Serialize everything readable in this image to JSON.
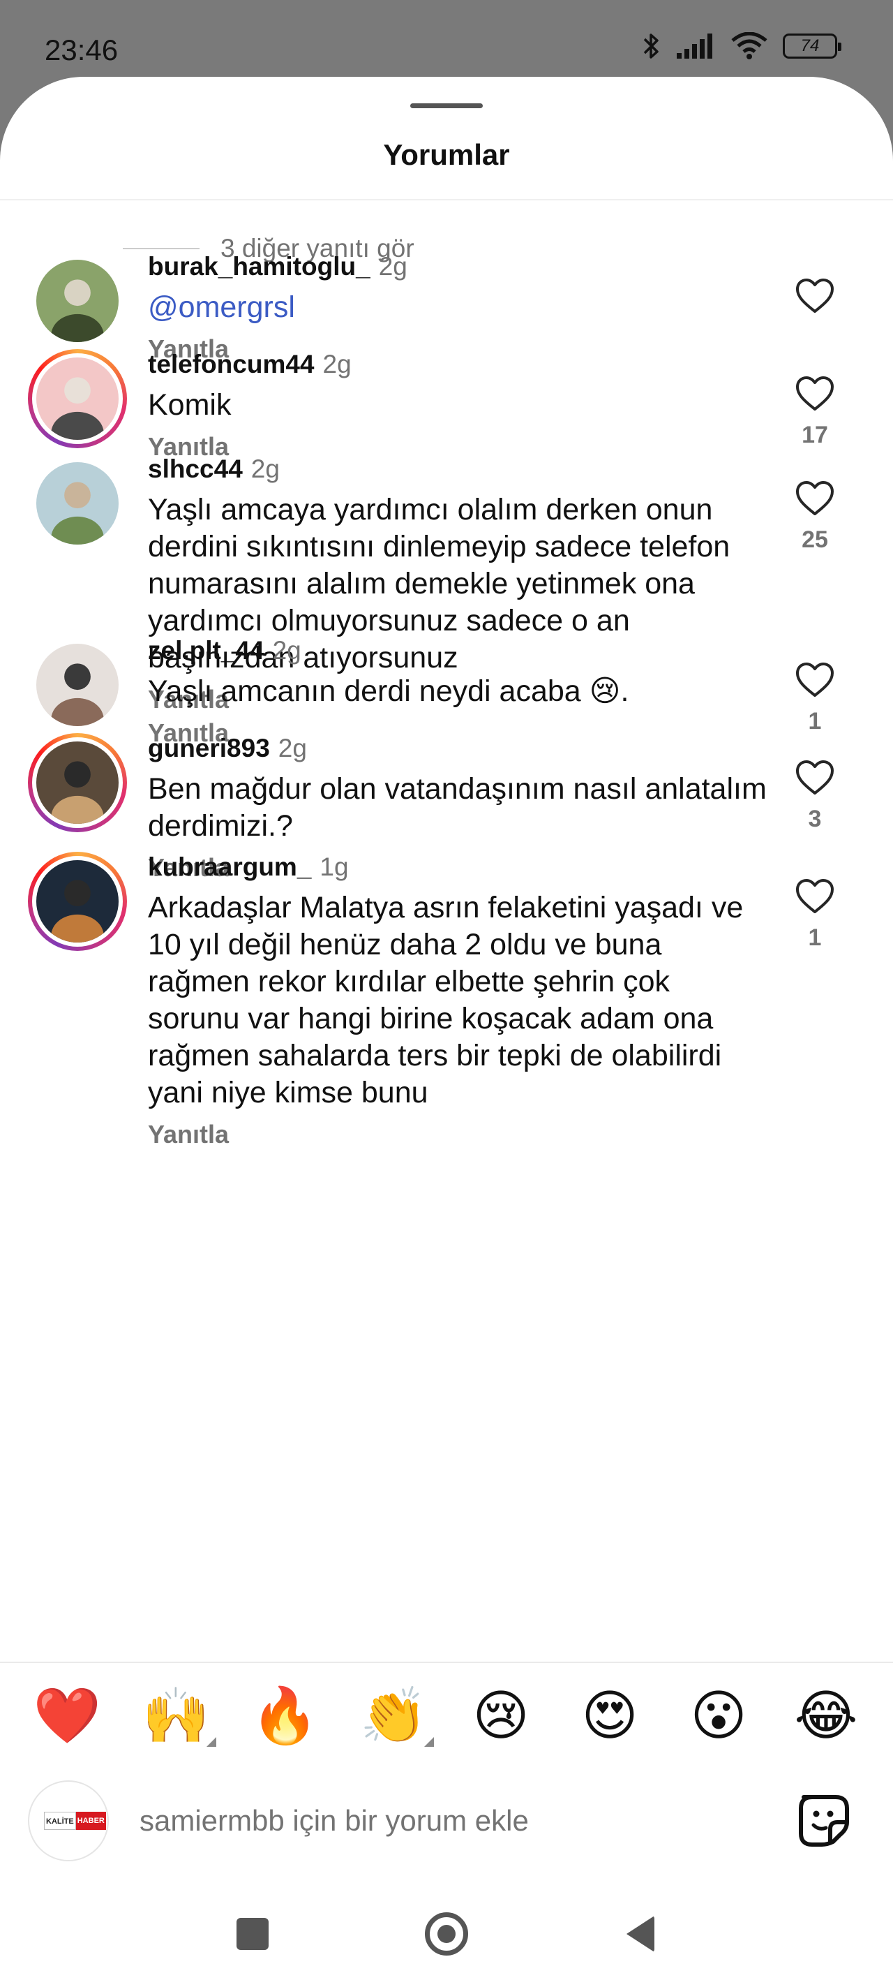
{
  "status_bar": {
    "time": "23:46",
    "battery": "74"
  },
  "sheet": {
    "title": "Yorumlar"
  },
  "more_replies": "3 diğer yanıtı gör",
  "reply_label": "Yanıtla",
  "comments": [
    {
      "user": "burak_hamitoglu_",
      "time": "2g",
      "text": "@omergrsl",
      "likes": "",
      "ring": false,
      "avatar_colors": [
        "#8aa36a",
        "#3c4a2c",
        "#d9d3c3"
      ]
    },
    {
      "user": "telefoncum44",
      "time": "2g",
      "text": "Komik",
      "likes": "17",
      "ring": true,
      "avatar_colors": [
        "#f3c7c7",
        "#4a4a4a",
        "#e8e0d8"
      ]
    },
    {
      "user": "slhcc44",
      "time": "2g",
      "text": "Yaşlı amcaya yardımcı olalım derken onun derdini sıkıntısını dinlemeyip sadece telefon numarasını alalım demekle yetinmek ona yardımcı olmuyorsunuz sadece o an başınızdan atıyorsunuz",
      "likes": "25",
      "ring": false,
      "avatar_colors": [
        "#b8d0d8",
        "#6f8d52",
        "#c9b49a"
      ]
    },
    {
      "user": "zel.plt_44",
      "time": "2g",
      "text": "Yaşlı amcanın derdi neydi acaba 😢.",
      "likes": "1",
      "ring": false,
      "avatar_colors": [
        "#e6e0dc",
        "#8a6a5a",
        "#3a3a3a"
      ]
    },
    {
      "user": "guneri893",
      "time": "2g",
      "text": "Ben mağdur olan vatandaşınım nasıl anlatalım derdimizi.?",
      "likes": "3",
      "ring": true,
      "avatar_colors": [
        "#5a4a3a",
        "#c8a070",
        "#2a2a2a"
      ]
    },
    {
      "user": "kubraargum_",
      "time": "1g",
      "text": "Arkadaşlar Malatya asrın felaketini yaşadı ve 10 yıl değil henüz daha 2 oldu ve buna rağmen rekor kırdılar elbette şehrin çok sorunu var hangi birine koşacak adam ona rağmen sahalarda ters bir tepki de olabilirdi yani niye kimse bunu",
      "likes": "1",
      "ring": true,
      "avatar_colors": [
        "#1d2a3a",
        "#c07a3a",
        "#2a2a2a"
      ]
    }
  ],
  "emoji_bar": [
    "❤️",
    "🙌",
    "🔥",
    "👏",
    "😢",
    "😍",
    "😮",
    "😂"
  ],
  "composer": {
    "placeholder": "samiermbb için bir yorum ekle",
    "brand_part1": "KALİTE",
    "brand_part2": "HABER"
  },
  "icons": {
    "like": "heart-outline-icon",
    "sticker": "sticker-icon",
    "bluetooth": "bluetooth-icon",
    "signal": "signal-icon",
    "wifi": "wifi-icon"
  }
}
